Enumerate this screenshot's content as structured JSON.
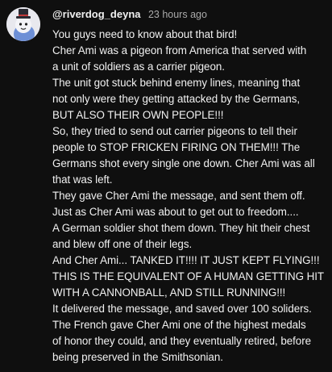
{
  "comment": {
    "author": "@riverdog_deyna",
    "time": "23 hours ago",
    "lines": [
      "You guys need to know about that bird!",
      "Cher Ami was a pigeon from America that served with",
      "a unit of soldiers as a carrier pigeon.",
      "The unit got stuck behind enemy lines, meaning that",
      "not only were they getting attacked by the Germans,",
      "BUT ALSO THEIR OWN PEOPLE!!!",
      "So, they tried to send out carrier pigeons to tell their",
      "people to STOP FRICKEN FIRING ON THEM!!! The",
      "Germans shot every single one down. Cher Ami was all",
      "that was left.",
      "They gave Cher Ami the message, and sent them off.",
      "Just as Cher Ami was about to get out to freedom....",
      "A German soldier shot them down. They hit their chest",
      "and blew off one of their legs.",
      "And Cher Ami... TANKED IT!!!! IT JUST KEPT FLYING!!!",
      "THIS IS THE EQUIVALENT OF A HUMAN GETTING HIT",
      "WITH A CANNONBALL, AND STILL RUNNING!!!",
      "It delivered the message, and saved over 100 soliders.",
      "The French gave Cher Ami one of the highest medals",
      "of honor they could, and they eventually retired, before",
      "being preserved in the Smithsonian."
    ]
  },
  "icons": {
    "avatar": "avatar-top-hat-character"
  }
}
